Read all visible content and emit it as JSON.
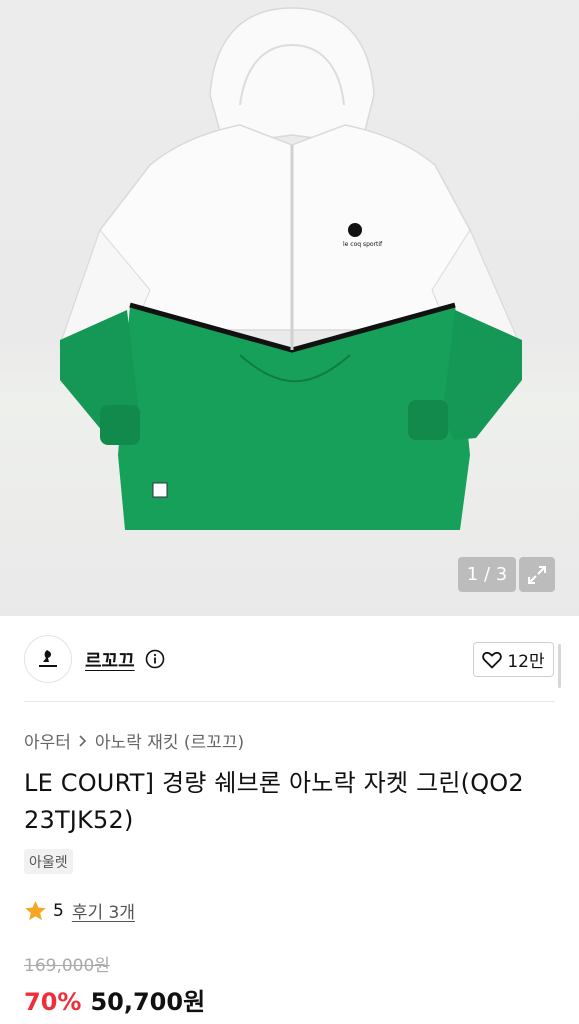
{
  "gallery": {
    "counter": "1 / 3",
    "expand_icon": "expand-icon"
  },
  "brand": {
    "name": "르꼬끄",
    "logo_icon": "le-coq-sportif-logo",
    "info_icon": "info-icon"
  },
  "like": {
    "icon": "heart-icon",
    "count": "12만"
  },
  "breadcrumb": {
    "category": "아우터",
    "separator_icon": "chevron-right-icon",
    "subcategory": "아노락 재킷 (르꼬끄)"
  },
  "product": {
    "title": "LE COURT] 경량 쉐브론 아노락 자켓 그린(QO2 23TJK52)",
    "tag": "아울렛"
  },
  "rating": {
    "star_icon": "star-icon",
    "score": "5",
    "review_link": "후기 3개"
  },
  "price": {
    "original": "169,000원",
    "discount": "70%",
    "sale": "50,700원"
  },
  "colors": {
    "jacket_green": "#17a05a",
    "discount_red": "#ee2e3b",
    "star_orange": "#f5a623"
  }
}
